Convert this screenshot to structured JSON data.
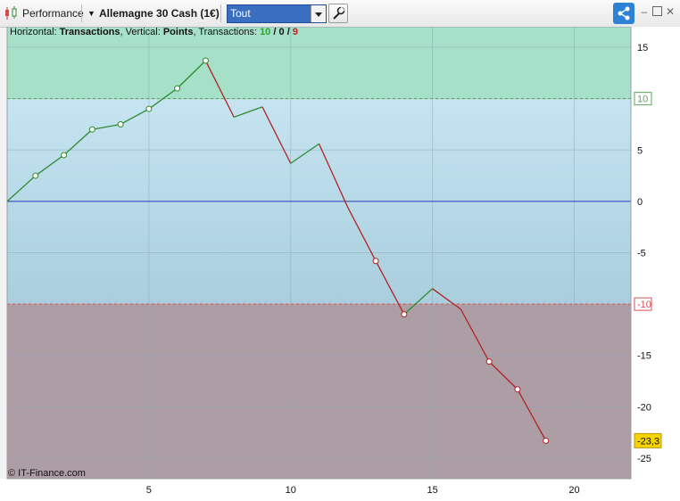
{
  "toolbar": {
    "indicator_label": "Performance",
    "instrument": "Allemagne 30 Cash (1€)",
    "period_value": "Tout"
  },
  "legend": {
    "horizontal_label": "Horizontal:",
    "horizontal_value": "Transactions",
    "vertical_label": "Vertical:",
    "vertical_value": "Points",
    "transactions_label": "Transactions:",
    "winning": "10",
    "neutral": "0",
    "losing": "9",
    "slash": "/"
  },
  "copyright": "© IT-Finance.com",
  "colors": {
    "up_line": "#2e8b2e",
    "down_line": "#b22222",
    "zero_line": "#2a3fb0",
    "upper_zone": "#a6e0c8",
    "middle_zone_top": "#c6e4f2",
    "middle_zone_bottom": "#a9cedd",
    "lower_zone": "#ad9ea6",
    "upper_threshold": "#53a853",
    "lower_threshold": "#d85050",
    "last_value_bg": "#f5d400"
  },
  "chart_data": {
    "type": "line",
    "x": [
      0,
      1,
      2,
      3,
      4,
      5,
      6,
      7,
      8,
      9,
      10,
      11,
      12,
      13,
      14,
      15,
      16,
      17,
      18,
      19
    ],
    "y": [
      0,
      2.5,
      4.5,
      7.0,
      7.5,
      9.0,
      11.0,
      13.7,
      8.2,
      9.2,
      3.7,
      5.6,
      -0.5,
      -5.8,
      -11.0,
      -8.5,
      -10.5,
      -15.6,
      -18.3,
      -23.3
    ],
    "markers": [
      1,
      2,
      3,
      4,
      5,
      6,
      7,
      13,
      14,
      17,
      18,
      19
    ],
    "xlim": [
      0,
      22
    ],
    "ylim": [
      -27,
      17
    ],
    "xticks": [
      5,
      10,
      15,
      20
    ],
    "yticks": [
      15,
      10,
      5,
      0,
      -5,
      -10,
      -15,
      -20,
      -25
    ],
    "upper_threshold": 10,
    "lower_threshold": -10,
    "last_value_label": "-23,3",
    "grid": true
  }
}
